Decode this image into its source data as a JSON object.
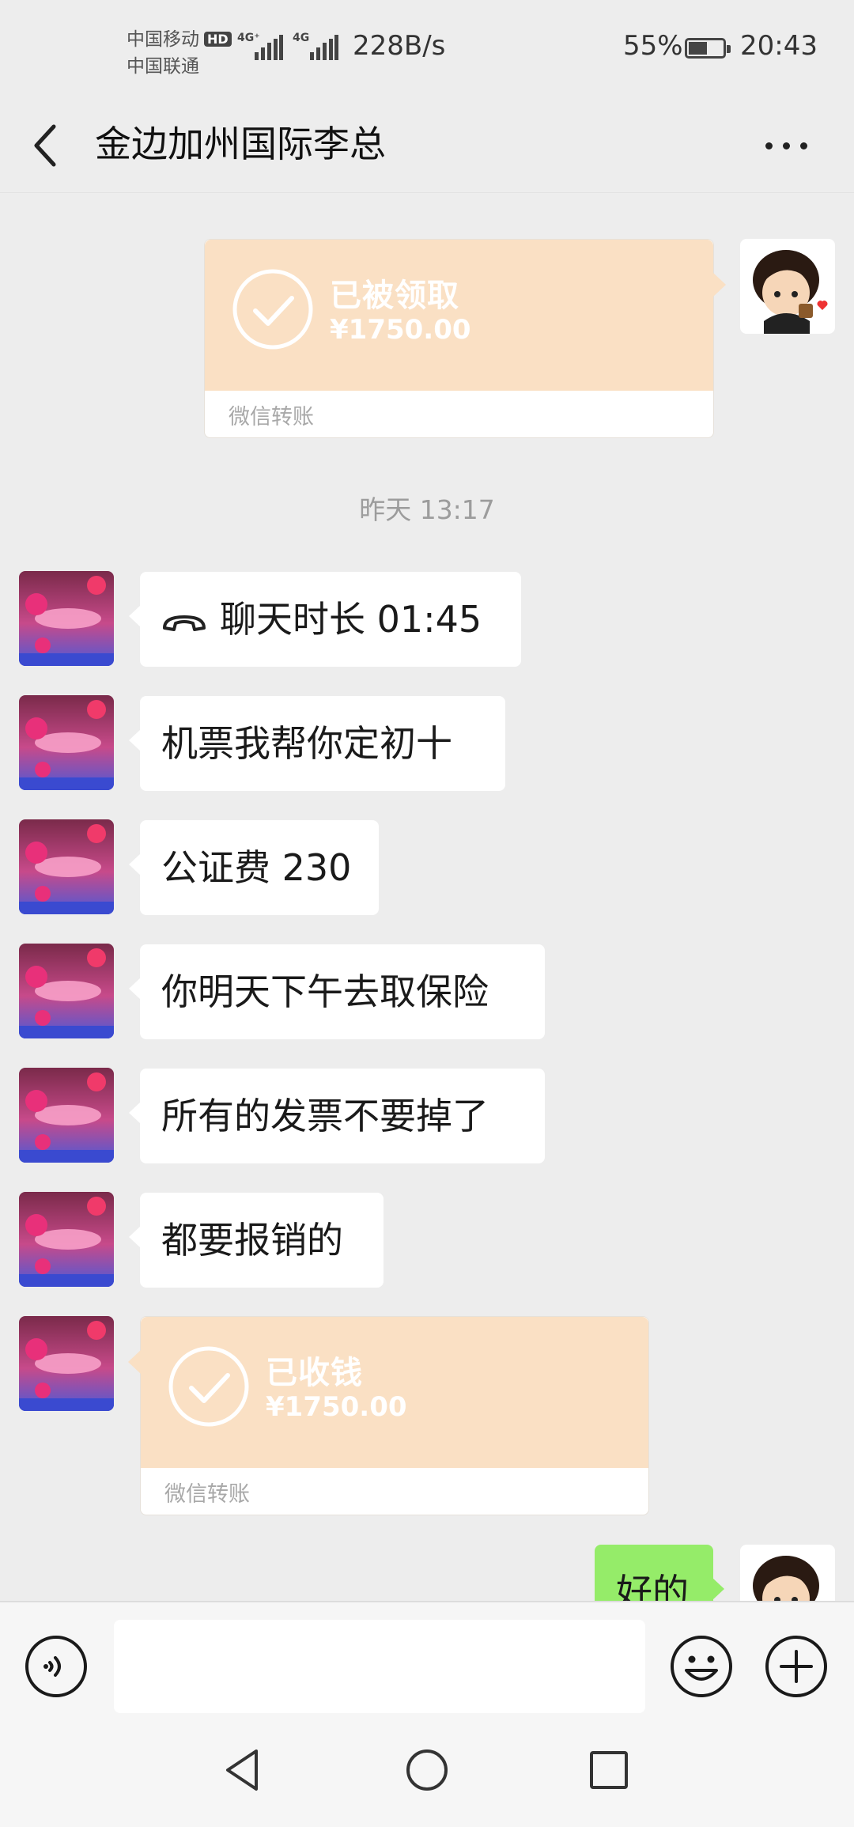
{
  "status_bar": {
    "carrier_1": "中国移动",
    "carrier_1_badge": "HD",
    "carrier_2": "中国联通",
    "network_1": "4G⁺",
    "network_2": "4G",
    "net_speed": "228B/s",
    "battery_percent": "55%",
    "battery_level": 0.55,
    "time": "20:43"
  },
  "header": {
    "contact_name": "金边加州国际李总",
    "back_icon": "chevron-left-icon",
    "more_icon": "more-horizontal-icon"
  },
  "messages": {
    "sent_transfer": {
      "status": "已被领取",
      "amount": "¥1750.00",
      "label": "微信转账"
    },
    "timestamp": "昨天 13:17",
    "call_record": {
      "icon": "phone-hangup-icon",
      "text": "聊天时长 01:45"
    },
    "received_texts": [
      "机票我帮你定初十",
      "公证费 230",
      "你明天下午去取保险",
      "所有的发票不要掉了",
      "都要报销的"
    ],
    "received_transfer": {
      "status": "已收钱",
      "amount": "¥1750.00",
      "label": "微信转账"
    },
    "sent_reply": "好的"
  },
  "input_bar": {
    "voice_icon": "voice-icon",
    "emoji_icon": "emoji-icon",
    "plus_icon": "plus-icon",
    "value": ""
  },
  "nav_bar": {
    "back_icon": "triangle-back-icon",
    "home_icon": "circle-home-icon",
    "recents_icon": "square-recents-icon"
  },
  "colors": {
    "background": "#ededed",
    "bubble_sent": "#95ec69",
    "bubble_received": "#ffffff",
    "transfer_card": "#fae0c4"
  }
}
